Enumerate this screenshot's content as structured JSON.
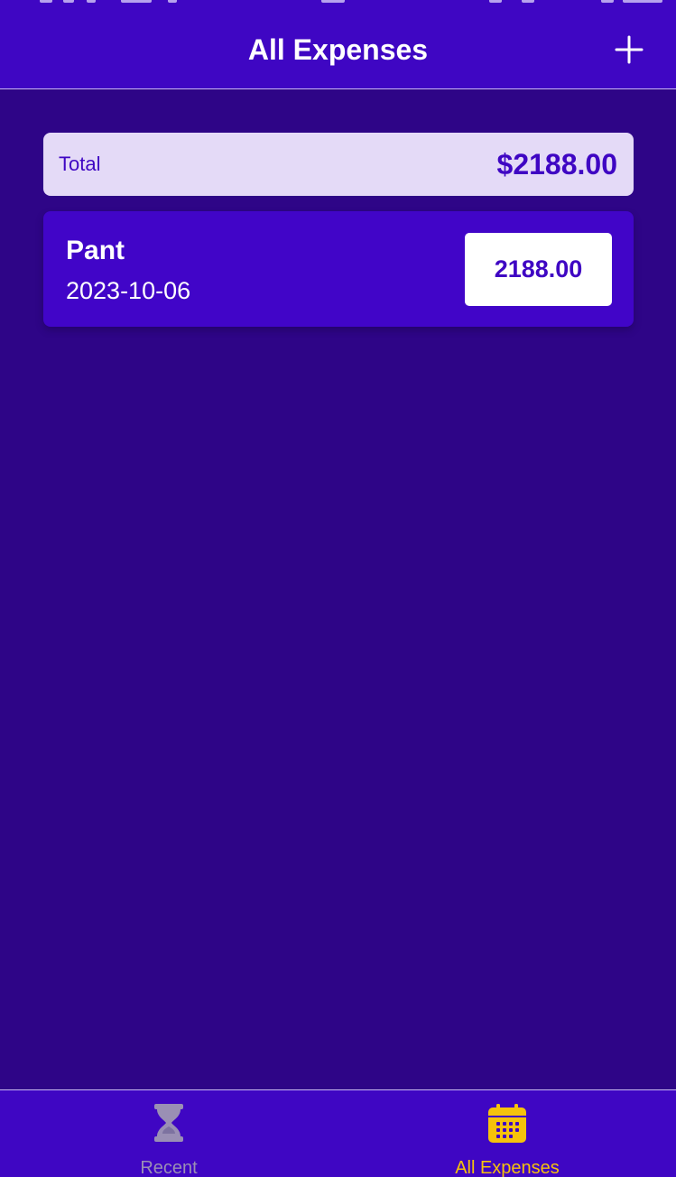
{
  "header": {
    "title": "All Expenses",
    "add_icon": "plus-icon"
  },
  "summary": {
    "label": "Total",
    "value": "$2188.00"
  },
  "expenses": [
    {
      "description": "Pant",
      "date": "2023-10-06",
      "amount": "2188.00"
    }
  ],
  "tabs": [
    {
      "label": "Recent",
      "icon": "hourglass-icon",
      "active": false
    },
    {
      "label": "All Expenses",
      "icon": "calendar-icon",
      "active": true
    }
  ],
  "colors": {
    "background": "#2e0587",
    "primary": "#3f06c3",
    "card": "#4105c8",
    "summary_bg": "#e4daf7",
    "accent": "#f6c20b",
    "inactive": "#9a8fb4"
  }
}
